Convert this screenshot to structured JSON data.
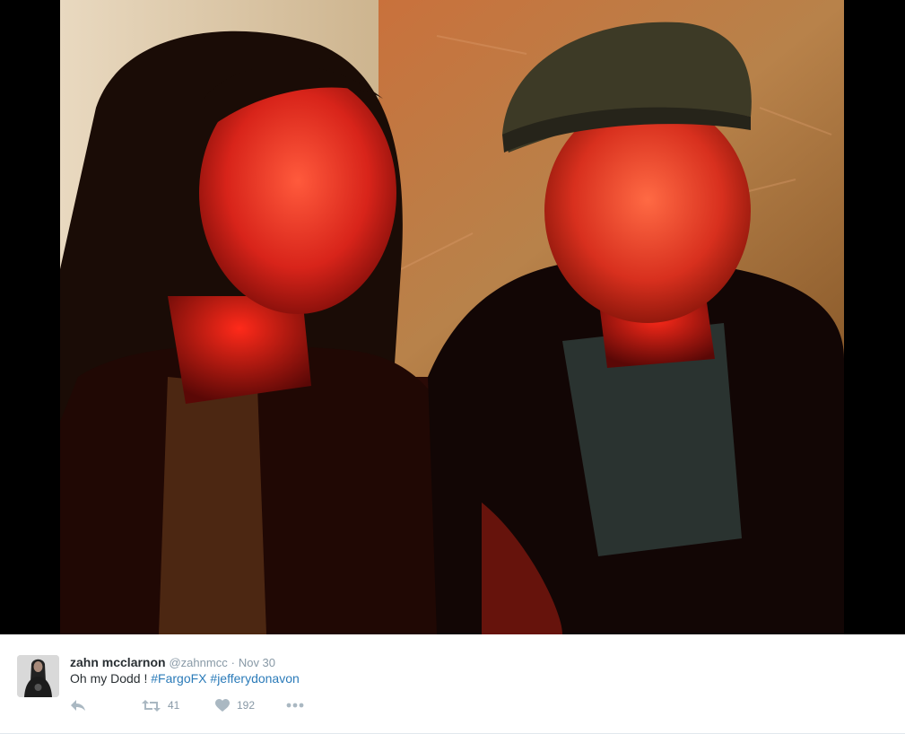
{
  "tweet": {
    "display_name": "zahn mcclarnon",
    "handle": "@zahnmcc",
    "separator": "·",
    "timestamp": "Nov 30",
    "text_prefix": "Oh my Dodd !",
    "hashtags": [
      "#FargoFX",
      "#jefferydonavon"
    ],
    "retweet_count": "41",
    "like_count": "192"
  },
  "icons": {
    "reply": "reply-icon",
    "retweet": "retweet-icon",
    "like": "heart-icon",
    "more": "more-icon"
  },
  "colors": {
    "link": "#2b7bb9",
    "muted": "#8899a6",
    "text": "#292f33"
  }
}
